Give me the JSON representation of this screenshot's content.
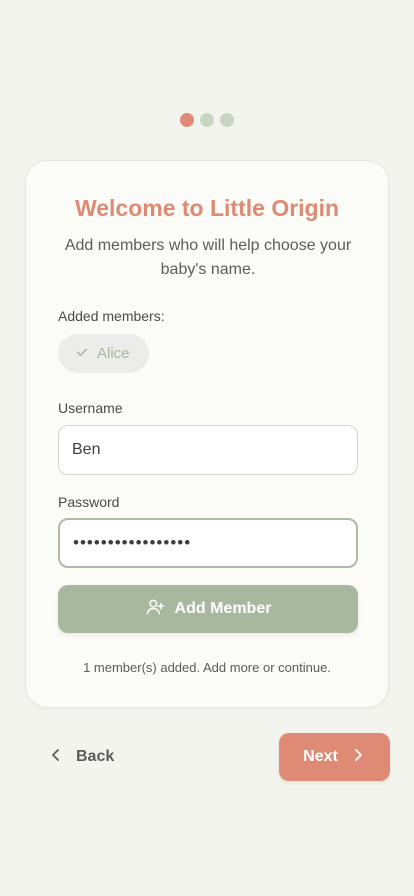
{
  "progress": {
    "current_step": 1,
    "total_steps": 3
  },
  "card": {
    "title": "Welcome to Little Origin",
    "subtitle": "Add members who will help choose your baby's name.",
    "added_members_label": "Added members:",
    "members": [
      {
        "name": "Alice",
        "icon": "check-icon"
      }
    ],
    "username_label": "Username",
    "username_value": "Ben",
    "password_label": "Password",
    "password_value": "•••••••••••••••••",
    "add_member_label": "Add Member",
    "add_member_icon": "user-plus-icon",
    "status_text": "1 member(s) added. Add more or continue."
  },
  "nav": {
    "back_label": "Back",
    "next_label": "Next"
  },
  "colors": {
    "accent": "#de8a74",
    "sage": "#a8b89f",
    "background": "#f4f4ef"
  }
}
